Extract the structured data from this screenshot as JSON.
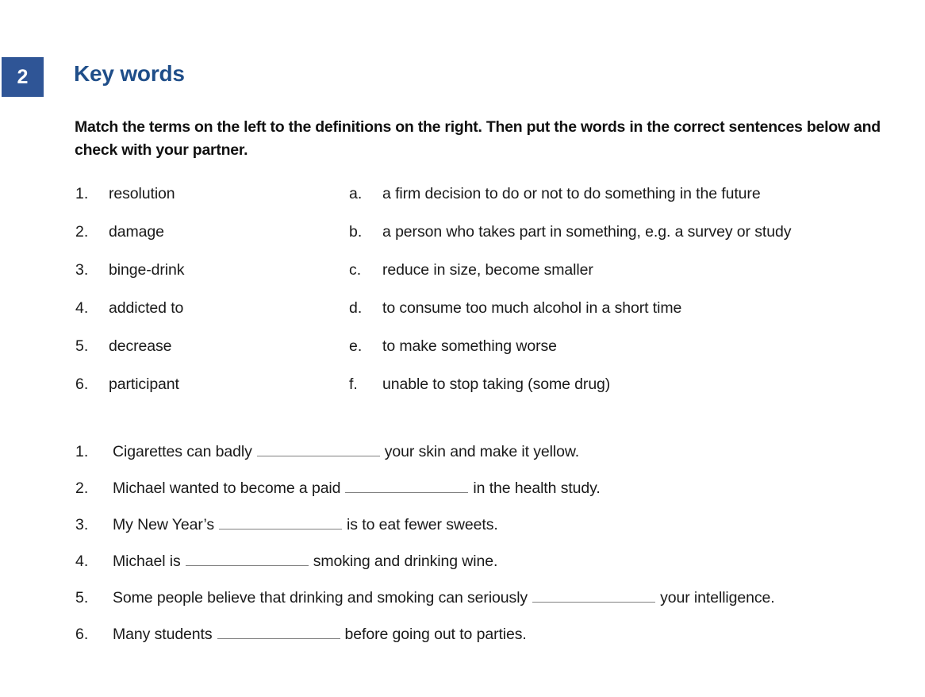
{
  "header": {
    "badge_number": "2",
    "title": "Key words",
    "badge_color": "#2F5596",
    "title_color": "#1F4E89"
  },
  "instructions": "Match the terms on the left to the definitions on the right. Then put the words in the correct sentences below and check with your partner.",
  "matching": {
    "terms": [
      {
        "num": "1.",
        "text": "resolution"
      },
      {
        "num": "2.",
        "text": "damage"
      },
      {
        "num": "3.",
        "text": "binge-drink"
      },
      {
        "num": "4.",
        "text": "addicted to"
      },
      {
        "num": "5.",
        "text": "decrease"
      },
      {
        "num": "6.",
        "text": "participant"
      }
    ],
    "definitions": [
      {
        "letter": "a.",
        "text": "a firm decision to do or not to do something in the future"
      },
      {
        "letter": "b.",
        "text": "a person who takes part in something, e.g. a survey or study"
      },
      {
        "letter": "c.",
        "text": "reduce in size, become smaller"
      },
      {
        "letter": "d.",
        "text": "to consume too much alcohol in a short time"
      },
      {
        "letter": "e.",
        "text": "to make something worse"
      },
      {
        "letter": "f.",
        "text": "unable to stop taking (some drug)"
      }
    ]
  },
  "sentences": [
    {
      "num": "1.",
      "before": "Cigarettes can badly",
      "after": "your skin and make it yellow."
    },
    {
      "num": "2.",
      "before": "Michael wanted to become a paid",
      "after": "in the health study."
    },
    {
      "num": "3.",
      "before": "My New Year’s",
      "after": "is to eat fewer sweets."
    },
    {
      "num": "4.",
      "before": "Michael is",
      "after": "smoking and drinking wine."
    },
    {
      "num": "5.",
      "before": "Some people believe that drinking and smoking can seriously",
      "after": "your intelligence."
    },
    {
      "num": "6.",
      "before": "Many students",
      "after": "before going out to parties."
    }
  ]
}
